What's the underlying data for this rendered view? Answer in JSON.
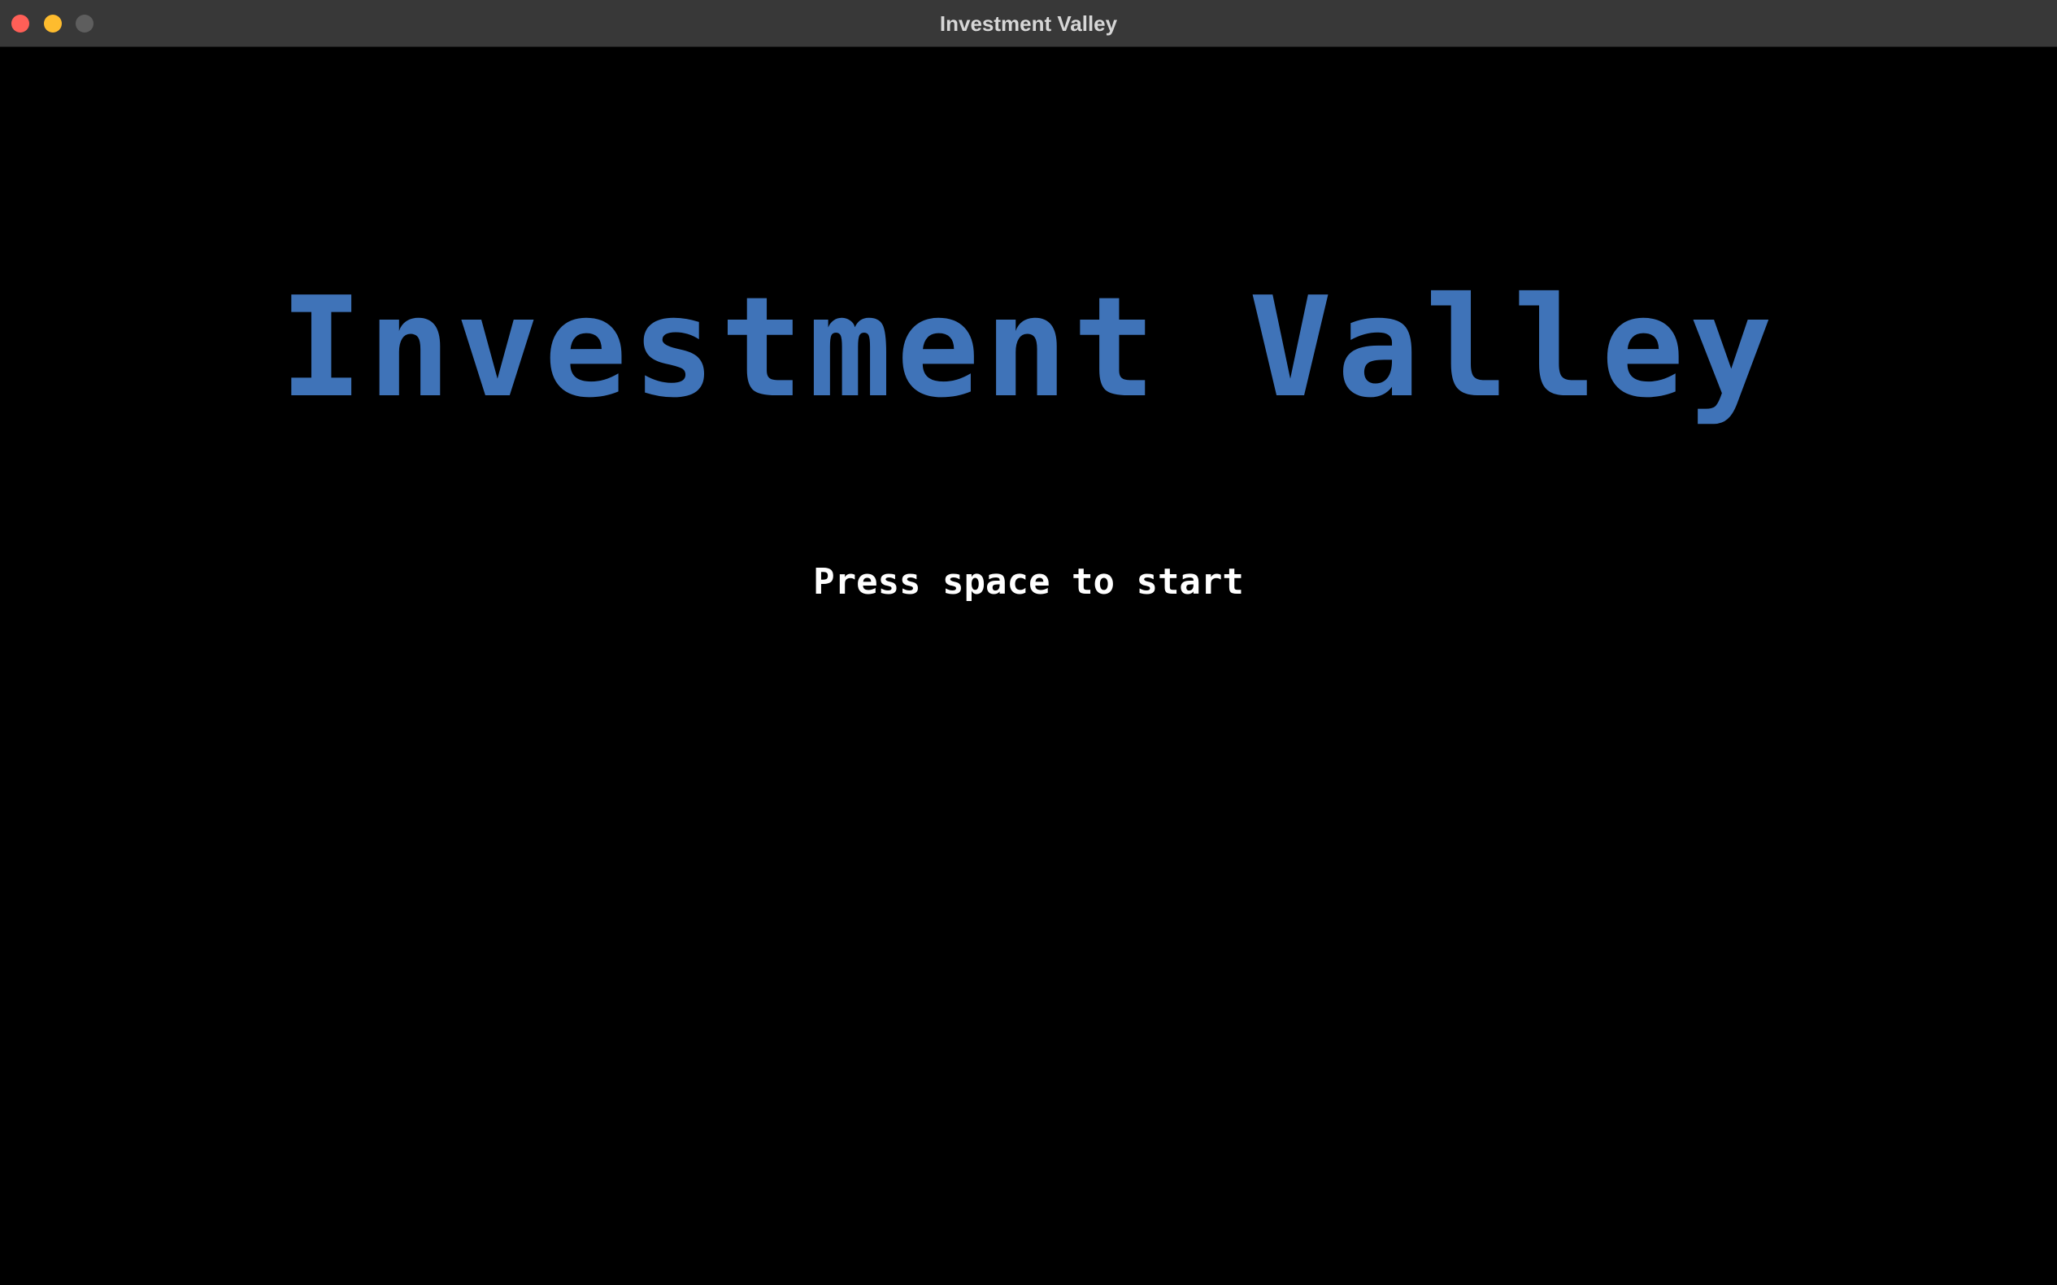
{
  "window": {
    "title": "Investment Valley",
    "controls": {
      "close_color": "#ff5f57",
      "minimize_color": "#febc2e",
      "zoom_color": "#5e5e5e"
    }
  },
  "game": {
    "title": "Investment Valley",
    "title_color": "#3f73b8",
    "prompt": "Press space to start",
    "prompt_color": "#ffffff",
    "background_color": "#000000"
  }
}
